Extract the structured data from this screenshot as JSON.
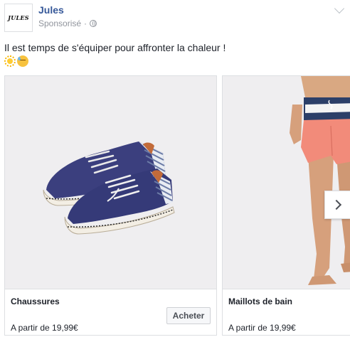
{
  "header": {
    "logo_text": "JULES",
    "page_name": "Jules",
    "sponsored": "Sponsorisé",
    "separator": "·"
  },
  "post": {
    "message": "Il est temps de s'équiper pour affronter la chaleur !",
    "emojis": [
      "sun-icon",
      "sweat-icon"
    ]
  },
  "carousel": {
    "cards": [
      {
        "title": "Chaussures",
        "price": "A partir de 19,99€",
        "button_label": "Acheter",
        "image": "navy-canvas-shoes"
      },
      {
        "title": "Maillots de bain",
        "price": "A partir de 19,99€",
        "image": "coral-swim-shorts"
      }
    ]
  },
  "colors": {
    "page_name": "#365899",
    "meta_gray": "#90949c",
    "text": "#1d2129",
    "border": "#dddfe2",
    "image_bg": "#efeef0"
  }
}
